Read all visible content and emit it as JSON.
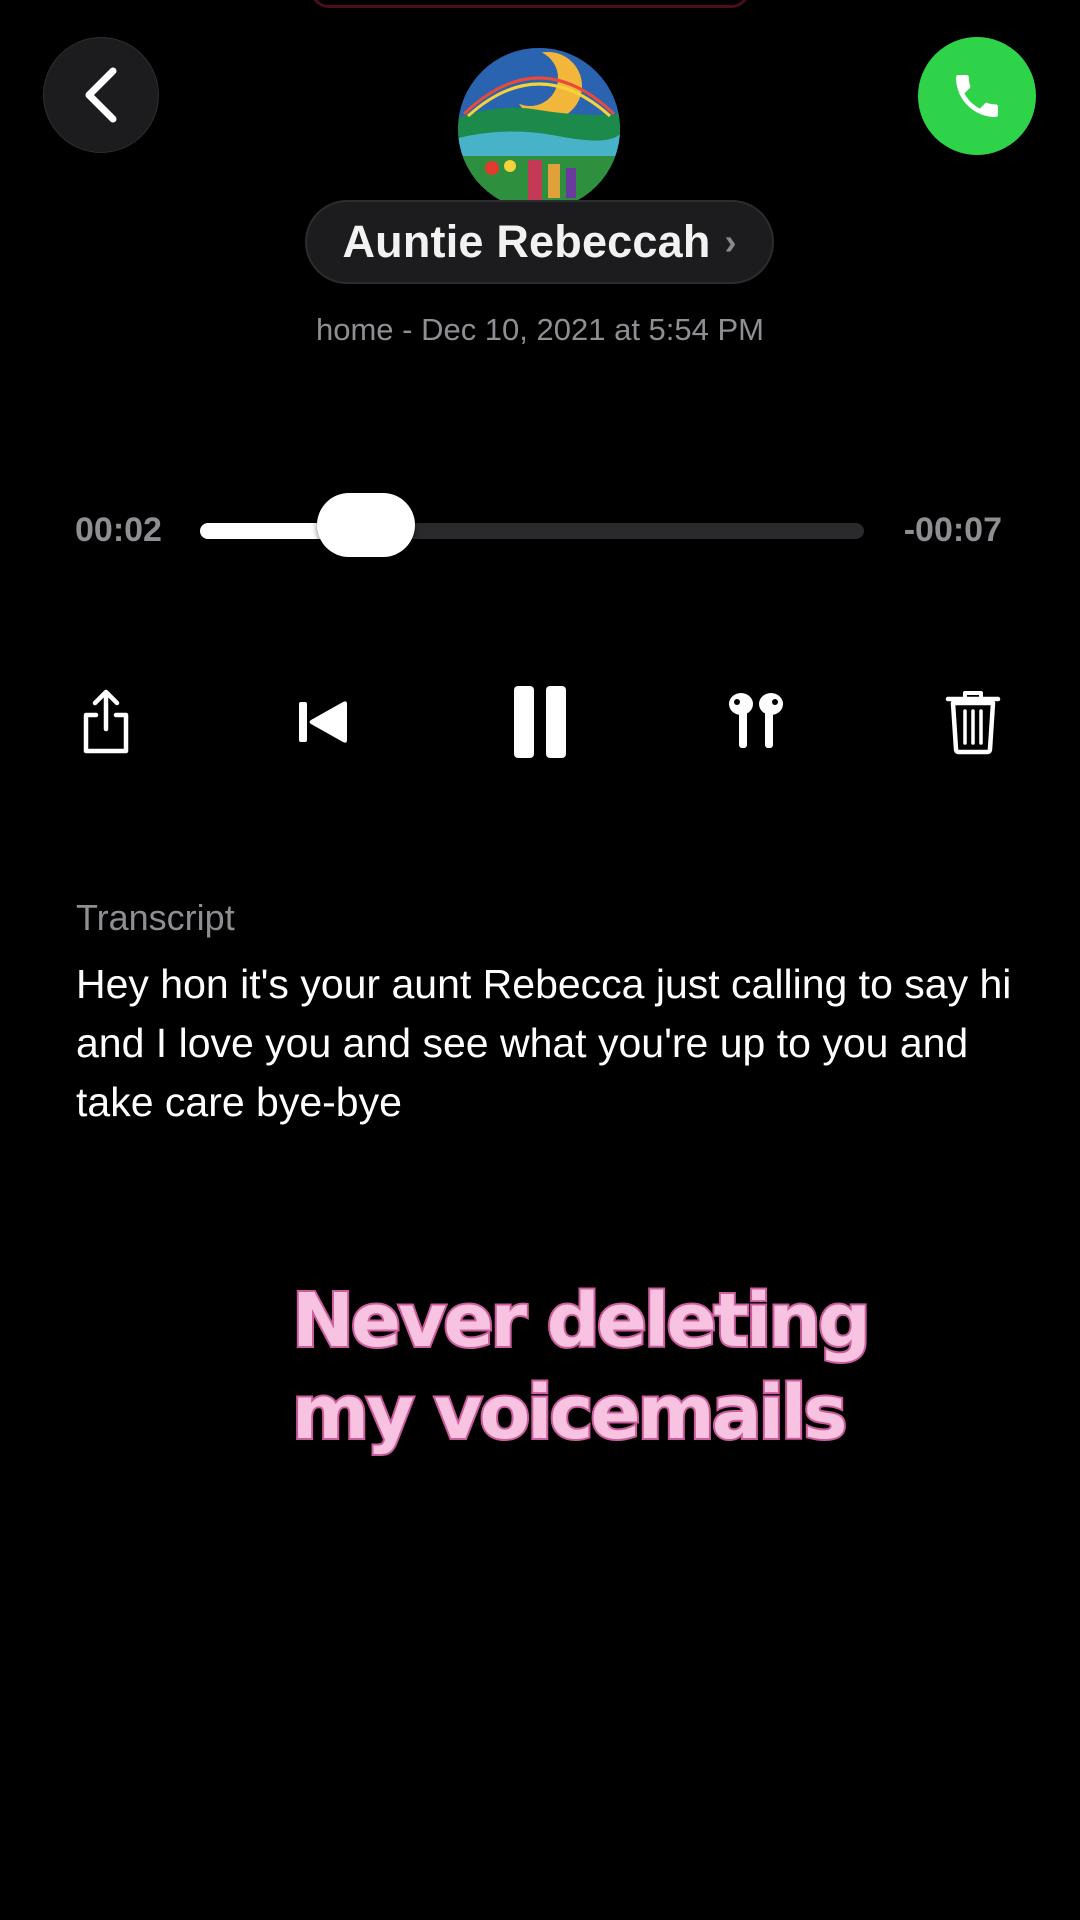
{
  "header": {
    "contact_name": "Auntie Rebeccah",
    "chevron": "›",
    "meta": "home - Dec 10, 2021 at 5:54 PM"
  },
  "player": {
    "elapsed": "00:02",
    "remaining": "-00:07",
    "progress": 0.25
  },
  "controls": [
    {
      "name": "share",
      "icon": "share-icon"
    },
    {
      "name": "rewind",
      "icon": "skip-back-icon"
    },
    {
      "name": "pause",
      "icon": "pause-icon"
    },
    {
      "name": "audio-route",
      "icon": "airpods-icon"
    },
    {
      "name": "delete",
      "icon": "trash-icon"
    }
  ],
  "transcript": {
    "label": "Transcript",
    "text": "Hey hon it's your aunt Rebecca just calling to say hi and I love you and see what you're up to you and take care bye-bye"
  },
  "overlay": {
    "line1": "Never deleting",
    "line2": "my voicemails"
  },
  "colors": {
    "background": "#000000",
    "call_green": "#2fd34a",
    "secondary_text": "#8e8e93",
    "caption_fill": "#f7c3e0",
    "caption_stroke": "#cc5d9d"
  }
}
